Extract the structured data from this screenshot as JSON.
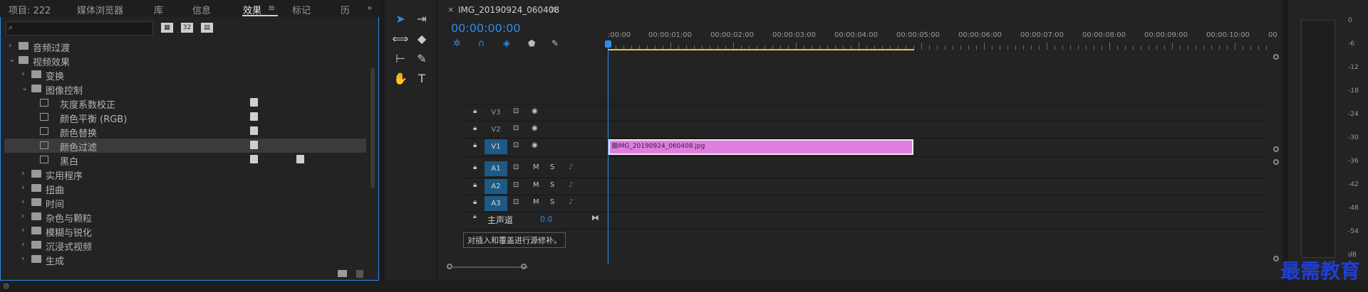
{
  "left_panel": {
    "tabs": [
      {
        "label": "项目: 222"
      },
      {
        "label": "媒体浏览器"
      },
      {
        "label": "库"
      },
      {
        "label": "信息"
      },
      {
        "label": "效果"
      },
      {
        "label": "标记"
      },
      {
        "label": "历"
      }
    ],
    "menu_icon": "hamburger-icon",
    "overflow_icon": "double-chevron-right-icon",
    "search": {
      "value": "",
      "placeholder": "",
      "icon": "search-icon"
    },
    "toolbar_badges": [
      "accelerated-icon",
      "32-bit-icon",
      "yuv-icon"
    ],
    "badge_texts": [
      "32"
    ],
    "tree": [
      {
        "label": "音频过渡",
        "level": 0,
        "expanded": false,
        "type": "folder"
      },
      {
        "label": "视频效果",
        "level": 0,
        "expanded": true,
        "type": "folder"
      },
      {
        "label": "变换",
        "level": 1,
        "expanded": false,
        "type": "folder"
      },
      {
        "label": "图像控制",
        "level": 1,
        "expanded": true,
        "type": "folder"
      },
      {
        "label": "灰度系数校正",
        "level": 2,
        "type": "effect",
        "badge1": true,
        "badge2": false
      },
      {
        "label": "颜色平衡 (RGB)",
        "level": 2,
        "type": "effect",
        "badge1": true,
        "badge2": false
      },
      {
        "label": "颜色替换",
        "level": 2,
        "type": "effect",
        "badge1": true,
        "badge2": false
      },
      {
        "label": "颜色过滤",
        "level": 2,
        "type": "effect",
        "badge1": true,
        "badge2": false,
        "selected": true
      },
      {
        "label": "黑白",
        "level": 2,
        "type": "effect",
        "badge1": true,
        "badge2": true
      },
      {
        "label": "实用程序",
        "level": 1,
        "expanded": false,
        "type": "folder"
      },
      {
        "label": "扭曲",
        "level": 1,
        "expanded": false,
        "type": "folder"
      },
      {
        "label": "时间",
        "level": 1,
        "expanded": false,
        "type": "folder"
      },
      {
        "label": "杂色与颗粒",
        "level": 1,
        "expanded": false,
        "type": "folder"
      },
      {
        "label": "模糊与锐化",
        "level": 1,
        "expanded": false,
        "type": "folder"
      },
      {
        "label": "沉浸式视频",
        "level": 1,
        "expanded": false,
        "type": "folder"
      },
      {
        "label": "生成",
        "level": 1,
        "expanded": false,
        "type": "folder"
      }
    ],
    "bottom_icons": [
      "new-folder-icon",
      "trash-icon"
    ]
  },
  "tools": [
    "selection-tool-icon",
    "track-select-icon",
    "ripple-edit-icon",
    "razor-icon",
    "slip-icon",
    "pen-icon",
    "hand-icon",
    "type-tool-icon"
  ],
  "timeline": {
    "close_glyph": "×",
    "sequence_name": "IMG_20190924_060408",
    "menu_glyph": "≡",
    "timecode": "00:00:00:00",
    "ruler": [
      ":00:00",
      "00:00:01:00",
      "00:00:02:00",
      "00:00:03:00",
      "00:00:04:00",
      "00:00:05:00",
      "00:00:06:00",
      "00:00:07:00",
      "00:00:08:00",
      "00:00:09:00",
      "00:00:10:00",
      "00"
    ],
    "video_tracks": [
      {
        "name": "V3",
        "active": false
      },
      {
        "name": "V2",
        "active": false
      },
      {
        "name": "V1",
        "active": true
      }
    ],
    "audio_tracks": [
      {
        "name": "A1",
        "m": "M",
        "s": "S"
      },
      {
        "name": "A2",
        "m": "M",
        "s": "S"
      },
      {
        "name": "A3",
        "m": "M",
        "s": "S"
      }
    ],
    "master": {
      "label": "主声道",
      "value": "0.0"
    },
    "clip": {
      "label": "IMG_20190924_060408.jpg",
      "color": "#df7edf"
    },
    "tooltip": "对插入和覆盖进行源修补。"
  },
  "meter": {
    "scale": [
      "0",
      "-6",
      "-12",
      "-18",
      "-24",
      "-30",
      "-36",
      "-42",
      "-48",
      "-54",
      "dB"
    ]
  },
  "watermark": "最需教育",
  "colors": {
    "accent": "#2d8ceb",
    "work_area": "#e0d03a",
    "track_on": "#1d5a86"
  }
}
